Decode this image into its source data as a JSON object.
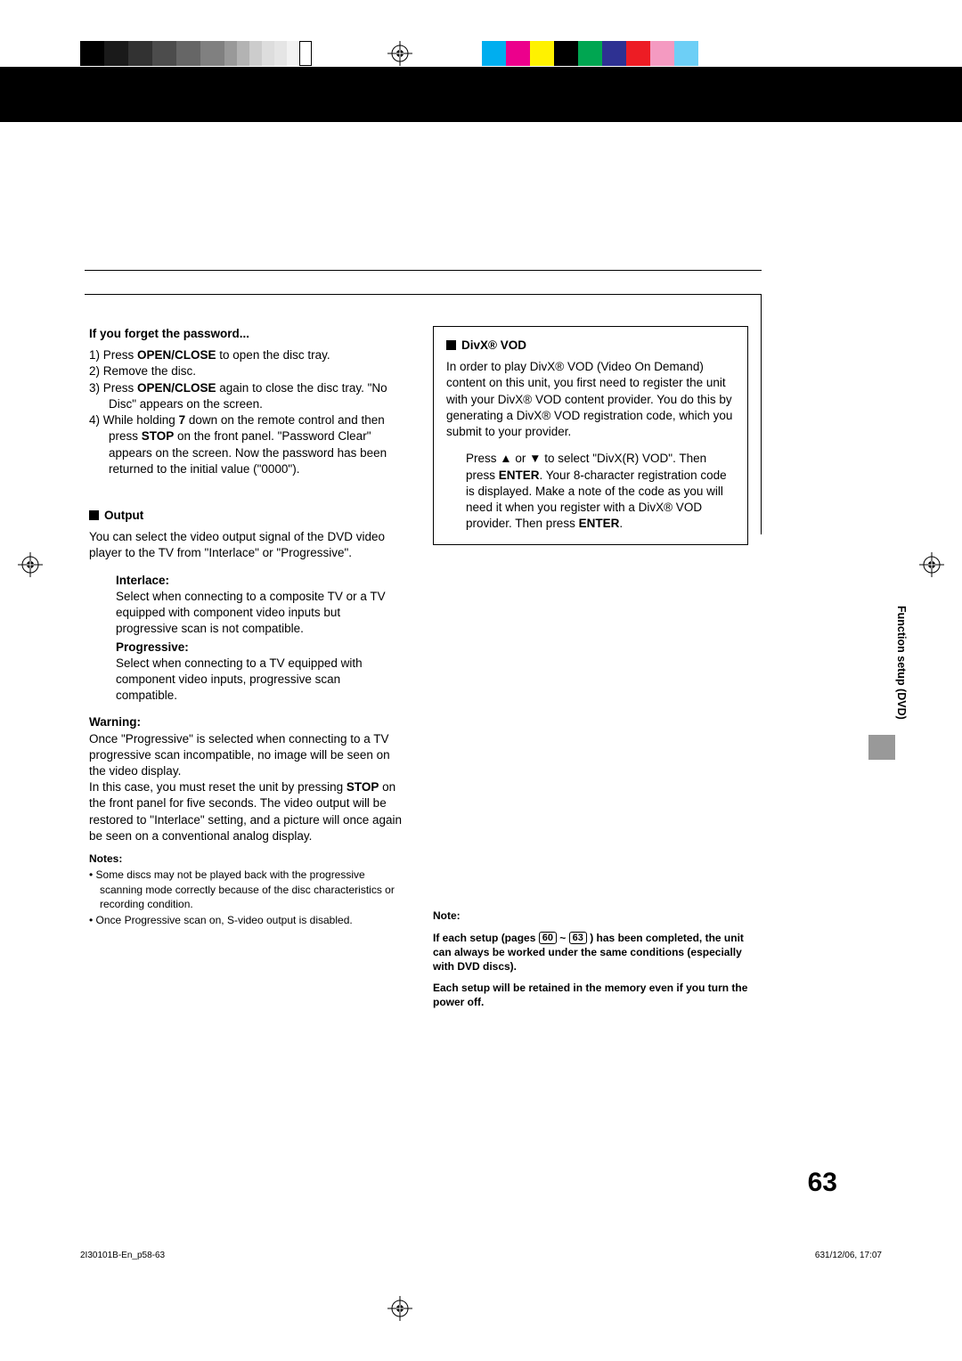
{
  "forgot": {
    "title": "If you forget the password...",
    "step1_pre": "1)  Press ",
    "step1_bold": "OPEN/CLOSE",
    "step1_post": " to open the disc tray.",
    "step2": "2)  Remove the disc.",
    "step3_pre": "3)  Press ",
    "step3_bold": "OPEN/CLOSE",
    "step3_post": " again to close the disc tray. \"No Disc\" appears on the screen.",
    "step4_pre": "4)  While holding ",
    "step4_bold1": "7",
    "step4_mid": " down on the remote control and then press ",
    "step4_bold2": "STOP",
    "step4_post": " on the front panel. \"Password Clear\" appears on the screen. Now the password has been returned to the initial value (\"0000\")."
  },
  "output": {
    "heading": "Output",
    "intro": "You can select the video output signal of the DVD video player to the TV from \"Interlace\" or \"Progressive\".",
    "interlace_label": "Interlace:",
    "interlace_body": "Select when connecting to a composite TV or a TV equipped with component video inputs but progressive scan is not compatible.",
    "progressive_label": "Progressive:",
    "progressive_body": "Select when connecting to a TV equipped with component video inputs, progressive scan compatible.",
    "warning_label": "Warning:",
    "warning_body1": "Once \"Progressive\" is selected when connecting to a TV progressive scan incompatible, no image will be seen on the video display.",
    "warning_body2_pre": "In this case, you must reset the unit by pressing ",
    "warning_body2_bold": "STOP",
    "warning_body2_post": " on the front panel for five seconds. The video output will be restored to \"Interlace\" setting, and a picture will once again be seen on a conventional analog display.",
    "notes_label": "Notes:",
    "note1": "Some discs may not be played back with the progressive scanning mode correctly because of the disc characteristics or recording condition.",
    "note2": "Once Progressive scan on, S-video output is disabled."
  },
  "divx": {
    "heading": "DivX® VOD",
    "intro": "In order to play DivX® VOD (Video On Demand) content on this unit, you first need to register the unit with your DivX® VOD content provider. You do this by generating a DivX® VOD registration code, which you submit to your provider.",
    "body_pre": "Press ▲ or ▼ to select \"DivX(R) VOD\". Then press ",
    "body_bold1": "ENTER",
    "body_mid": ". Your 8-character registration code is displayed. Make a note of the code as you will need it when you register with a DivX® VOD provider. Then press ",
    "body_bold2": "ENTER",
    "body_post": "."
  },
  "bottom_note": {
    "label": "Note:",
    "l1_pre": "If each setup (pages ",
    "l1_p1": "60",
    "l1_mid": " ~ ",
    "l1_p2": "63",
    "l1_post": " ) has been completed, the unit can always be worked under the same conditions (especially with DVD discs).",
    "l2": "Each setup will be retained in the memory even if you turn the power off."
  },
  "side_tab": "Function setup (DVD)",
  "page_number": "63",
  "footer": {
    "left": "2I30101B-En_p58-63",
    "mid": "63",
    "right": "1/12/06, 17:07"
  }
}
